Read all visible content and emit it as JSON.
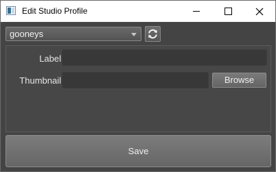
{
  "window": {
    "title": "Edit Studio Profile",
    "controls": {
      "minimize_icon": "minimize-icon",
      "maximize_icon": "maximize-icon",
      "close_glyph": "✕"
    }
  },
  "profile_selector": {
    "selected": "gooneys",
    "refresh_icon": "refresh-icon"
  },
  "form": {
    "label_caption": "Label",
    "label_value": "",
    "thumbnail_caption": "Thumbnail",
    "thumbnail_value": "",
    "browse_label": "Browse"
  },
  "actions": {
    "save_label": "Save"
  },
  "colors": {
    "background": "#444444",
    "titlebar": "#ffffff",
    "field_bg": "#383838",
    "button_top": "#7c7c7c",
    "button_bottom": "#666666"
  }
}
